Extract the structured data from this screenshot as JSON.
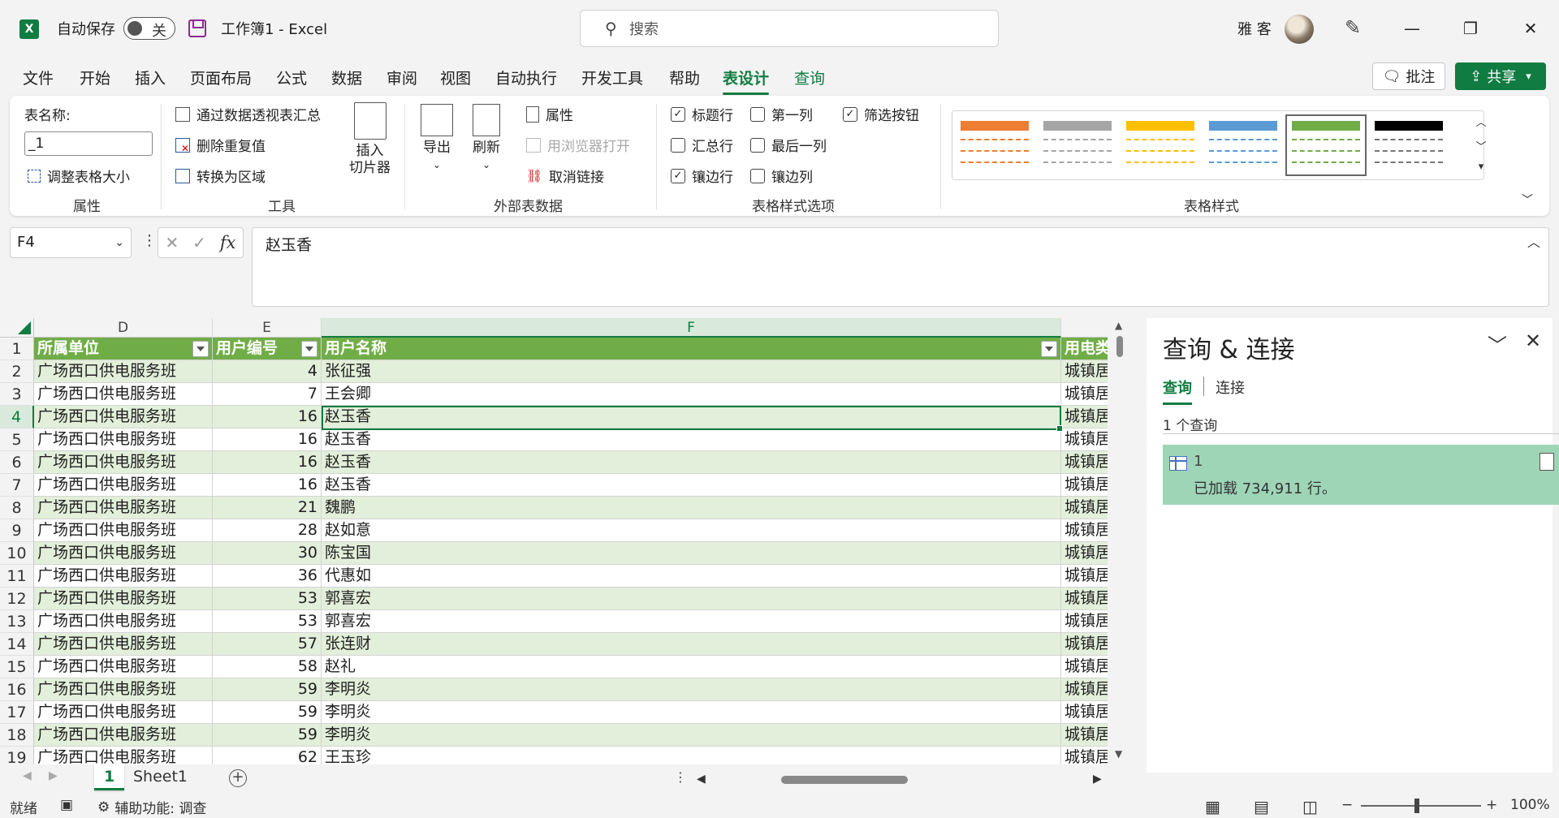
{
  "titlebar": {
    "autosave_label": "自动保存",
    "autosave_state": "关",
    "doc_title": "工作簿1  -  Excel",
    "search_placeholder": "搜索",
    "user_name": "雅 客",
    "minimize": "—",
    "restore": "❐",
    "close": "✕"
  },
  "menu": {
    "tabs": [
      "文件",
      "开始",
      "插入",
      "页面布局",
      "公式",
      "数据",
      "审阅",
      "视图",
      "自动执行",
      "开发工具",
      "帮助",
      "表设计",
      "查询"
    ],
    "active": "表设计",
    "comment": "批注",
    "share": "共享"
  },
  "ribbon": {
    "props": {
      "table_name_label": "表名称:",
      "table_name_value": "_1",
      "resize": "调整表格大小",
      "group": "属性"
    },
    "tools": {
      "pivot": "通过数据透视表汇总",
      "dedupe": "删除重复值",
      "convert": "转换为区域",
      "slicer_line1": "插入",
      "slicer_line2": "切片器",
      "group": "工具"
    },
    "external": {
      "export": "导出",
      "refresh": "刷新",
      "properties": "属性",
      "open_browser": "用浏览器打开",
      "unlink": "取消链接",
      "group": "外部表数据"
    },
    "style_options": {
      "header_row": "标题行",
      "total_row": "汇总行",
      "banded_rows": "镶边行",
      "first_col": "第一列",
      "last_col": "最后一列",
      "banded_cols": "镶边列",
      "filter_btn": "筛选按钮",
      "group": "表格样式选项"
    },
    "styles": {
      "group": "表格样式",
      "colors": [
        "#ed7d31",
        "#a5a5a5",
        "#ffc000",
        "#5b9bd5",
        "#70ad47",
        "#000000"
      ]
    }
  },
  "formula": {
    "cell_ref": "F4",
    "content": "赵玉香"
  },
  "grid": {
    "columns": [
      "D",
      "E",
      "F"
    ],
    "headers": [
      "所属单位",
      "用户编号",
      "用户名称",
      "用电类"
    ],
    "rows": [
      {
        "n": "1"
      },
      {
        "n": "2",
        "unit": "广场西口供电服务班",
        "id": "4",
        "name": "张征强",
        "type": "城镇居"
      },
      {
        "n": "3",
        "unit": "广场西口供电服务班",
        "id": "7",
        "name": "王会卿",
        "type": "城镇居"
      },
      {
        "n": "4",
        "unit": "广场西口供电服务班",
        "id": "16",
        "name": "赵玉香",
        "type": "城镇居"
      },
      {
        "n": "5",
        "unit": "广场西口供电服务班",
        "id": "16",
        "name": "赵玉香",
        "type": "城镇居"
      },
      {
        "n": "6",
        "unit": "广场西口供电服务班",
        "id": "16",
        "name": "赵玉香",
        "type": "城镇居"
      },
      {
        "n": "7",
        "unit": "广场西口供电服务班",
        "id": "16",
        "name": "赵玉香",
        "type": "城镇居"
      },
      {
        "n": "8",
        "unit": "广场西口供电服务班",
        "id": "21",
        "name": "魏鹏",
        "type": "城镇居"
      },
      {
        "n": "9",
        "unit": "广场西口供电服务班",
        "id": "28",
        "name": "赵如意",
        "type": "城镇居"
      },
      {
        "n": "10",
        "unit": "广场西口供电服务班",
        "id": "30",
        "name": "陈宝国",
        "type": "城镇居"
      },
      {
        "n": "11",
        "unit": "广场西口供电服务班",
        "id": "36",
        "name": "代惠如",
        "type": "城镇居"
      },
      {
        "n": "12",
        "unit": "广场西口供电服务班",
        "id": "53",
        "name": "郭喜宏",
        "type": "城镇居"
      },
      {
        "n": "13",
        "unit": "广场西口供电服务班",
        "id": "53",
        "name": "郭喜宏",
        "type": "城镇居"
      },
      {
        "n": "14",
        "unit": "广场西口供电服务班",
        "id": "57",
        "name": "张连财",
        "type": "城镇居"
      },
      {
        "n": "15",
        "unit": "广场西口供电服务班",
        "id": "58",
        "name": "赵礼",
        "type": "城镇居"
      },
      {
        "n": "16",
        "unit": "广场西口供电服务班",
        "id": "59",
        "name": "李明炎",
        "type": "城镇居"
      },
      {
        "n": "17",
        "unit": "广场西口供电服务班",
        "id": "59",
        "name": "李明炎",
        "type": "城镇居"
      },
      {
        "n": "18",
        "unit": "广场西口供电服务班",
        "id": "59",
        "name": "李明炎",
        "type": "城镇居"
      },
      {
        "n": "19",
        "unit": "广场西口供电服务班",
        "id": "62",
        "name": "王玉珍",
        "type": "城镇居"
      }
    ]
  },
  "sheets": {
    "tabs": [
      "1",
      "Sheet1"
    ],
    "active": "1"
  },
  "status": {
    "ready": "就绪",
    "accessibility": "辅助功能: 调查",
    "zoom": "100%",
    "zoom_minus": "−",
    "zoom_plus": "+"
  },
  "query_pane": {
    "title": "查询 & 连接",
    "tab_queries": "查询",
    "tab_connections": "连接",
    "count": "1 个查询",
    "item_name": "1",
    "item_status": "已加载 734,911 行。"
  }
}
